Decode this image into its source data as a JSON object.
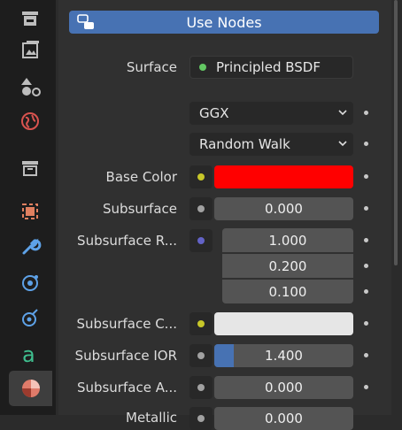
{
  "toolbar": {
    "use_nodes_label": "Use Nodes"
  },
  "surface": {
    "label": "Surface",
    "shader": "Principled BSDF",
    "socket_color": "#63c763"
  },
  "dropdowns": {
    "distribution": "GGX",
    "subsurface_method": "Random Walk"
  },
  "properties": [
    {
      "label": "Base Color",
      "value": "",
      "socket_color": "#c7c729",
      "color": "#ff0000"
    },
    {
      "label": "Subsurface",
      "value": "0.000",
      "socket_color": "#a1a1a1"
    },
    {
      "label": "Subsurface R...",
      "values": [
        "1.000",
        "0.200",
        "0.100"
      ],
      "socket_color": "#6363c7"
    },
    {
      "label": "Subsurface C...",
      "value": "",
      "socket_color": "#c7c729",
      "color": "#e6e6e6"
    },
    {
      "label": "Subsurface IOR",
      "value": "1.400",
      "socket_color": "#a1a1a1",
      "fill_fraction": 0.14
    },
    {
      "label": "Subsurface A...",
      "value": "0.000",
      "socket_color": "#a1a1a1"
    },
    {
      "label": "Metallic",
      "value": "0.000",
      "socket_color": "#a1a1a1"
    }
  ],
  "colors": {
    "accent": "#4772b3",
    "panel": "#303030",
    "sidebar": "#1d1d1d"
  },
  "sidebar_icons": [
    "render-icon",
    "output-icon",
    "view-layer-icon",
    "scene-icon",
    "world-icon",
    "collection-icon",
    "object-icon",
    "modifier-icon",
    "particles-icon",
    "physics-icon",
    "constraints-icon",
    "data-icon",
    "material-icon"
  ]
}
